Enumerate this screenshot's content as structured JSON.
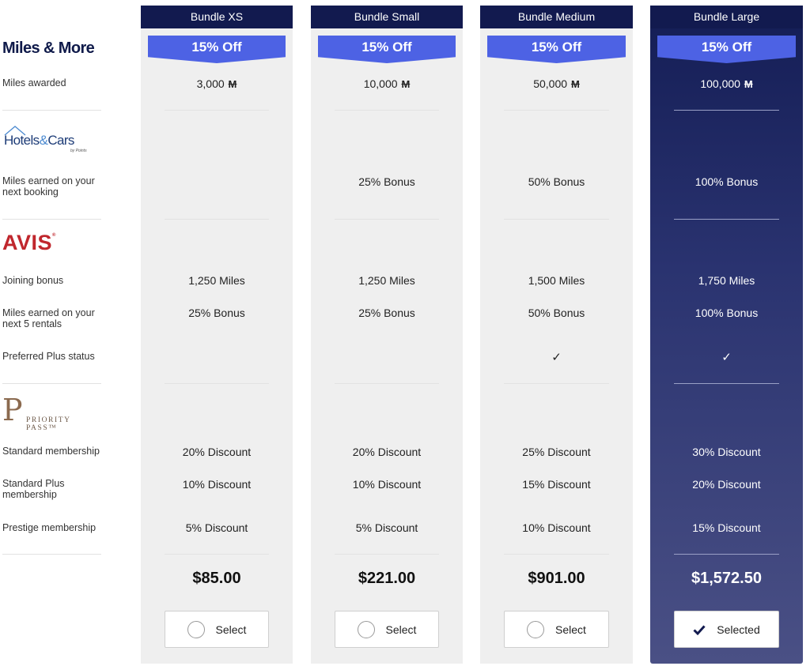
{
  "labels": {
    "miles_more_logo": "Miles & More",
    "miles_awarded": "Miles awarded",
    "hotels_cars_logo": {
      "word1": "Hotels",
      "amp": "&",
      "word2": "Cars",
      "by": "by Points"
    },
    "miles_next_booking": "Miles earned on your next booking",
    "avis_logo": "AVIS",
    "avis_reg": "®",
    "joining_bonus": "Joining bonus",
    "miles_next_rentals": "Miles earned on your next 5 rentals",
    "preferred_plus": "Preferred Plus status",
    "priority_pass_logo": {
      "letter": "P",
      "name": "PRIORITY PASS™"
    },
    "standard_membership": "Standard membership",
    "standard_plus_membership": "Standard Plus membership",
    "prestige_membership": "Prestige membership"
  },
  "miles_symbol": "M",
  "check_mark": "✓",
  "colors": {
    "header_navy": "#121a4f",
    "badge_blue": "#4d62e4",
    "avis_red": "#c0272d",
    "brand_navy": "#0f1a4a",
    "column_gray": "#efefef"
  },
  "bundles": [
    {
      "name": "Bundle XS",
      "discount": "15% Off",
      "miles": "3,000",
      "hotel_bonus": "",
      "avis_joining": "1,250 Miles",
      "avis_rentals": "25% Bonus",
      "preferred_plus": "",
      "pp_standard": "20% Discount",
      "pp_standard_plus": "10% Discount",
      "pp_prestige": "5% Discount",
      "price": "$85.00",
      "button_label": "Select",
      "selected": false
    },
    {
      "name": "Bundle Small",
      "discount": "15% Off",
      "miles": "10,000",
      "hotel_bonus": "25% Bonus",
      "avis_joining": "1,250 Miles",
      "avis_rentals": "25% Bonus",
      "preferred_plus": "",
      "pp_standard": "20% Discount",
      "pp_standard_plus": "10% Discount",
      "pp_prestige": "5% Discount",
      "price": "$221.00",
      "button_label": "Select",
      "selected": false
    },
    {
      "name": "Bundle Medium",
      "discount": "15% Off",
      "miles": "50,000",
      "hotel_bonus": "50% Bonus",
      "avis_joining": "1,500 Miles",
      "avis_rentals": "50% Bonus",
      "preferred_plus": "✓",
      "pp_standard": "25% Discount",
      "pp_standard_plus": "15% Discount",
      "pp_prestige": "10% Discount",
      "price": "$901.00",
      "button_label": "Select",
      "selected": false
    },
    {
      "name": "Bundle Large",
      "discount": "15% Off",
      "miles": "100,000",
      "hotel_bonus": "100% Bonus",
      "avis_joining": "1,750 Miles",
      "avis_rentals": "100% Bonus",
      "preferred_plus": "✓",
      "pp_standard": "30% Discount",
      "pp_standard_plus": "20% Discount",
      "pp_prestige": "15% Discount",
      "price": "$1,572.50",
      "button_label": "Selected",
      "selected": true
    }
  ]
}
